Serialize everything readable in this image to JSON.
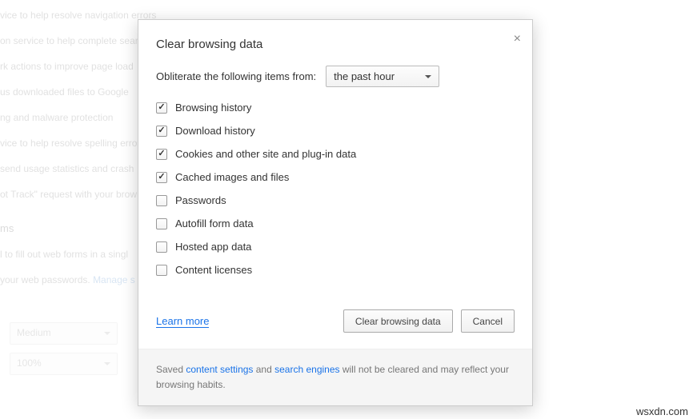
{
  "background": {
    "lines": [
      "vice to help resolve navigation errors",
      "on service to help complete sear",
      "rk actions to improve page load",
      "us downloaded files to Google",
      "ng and malware protection",
      "vice to help resolve spelling erro",
      "send usage statistics and crash",
      "ot Track\" request with your brow"
    ],
    "section_header": "ms",
    "form_line": "l to fill out web forms in a singl",
    "passwords_line_prefix": "your web passwords.  ",
    "passwords_link": "Manage s",
    "select1": "Medium",
    "select2": "100%"
  },
  "dialog": {
    "title": "Clear browsing data",
    "obliterate_label": "Obliterate the following items from:",
    "time_range": "the past hour",
    "items": [
      {
        "label": "Browsing history",
        "checked": true
      },
      {
        "label": "Download history",
        "checked": true
      },
      {
        "label": "Cookies and other site and plug-in data",
        "checked": true
      },
      {
        "label": "Cached images and files",
        "checked": true
      },
      {
        "label": "Passwords",
        "checked": false
      },
      {
        "label": "Autofill form data",
        "checked": false
      },
      {
        "label": "Hosted app data",
        "checked": false
      },
      {
        "label": "Content licenses",
        "checked": false
      }
    ],
    "learn_more": "Learn more",
    "clear_button": "Clear browsing data",
    "cancel_button": "Cancel",
    "footer_prefix": "Saved ",
    "footer_link1": "content settings",
    "footer_mid": " and ",
    "footer_link2": "search engines",
    "footer_suffix": " will not be cleared and may reflect your browsing habits."
  },
  "watermark": "wsxdn.com"
}
